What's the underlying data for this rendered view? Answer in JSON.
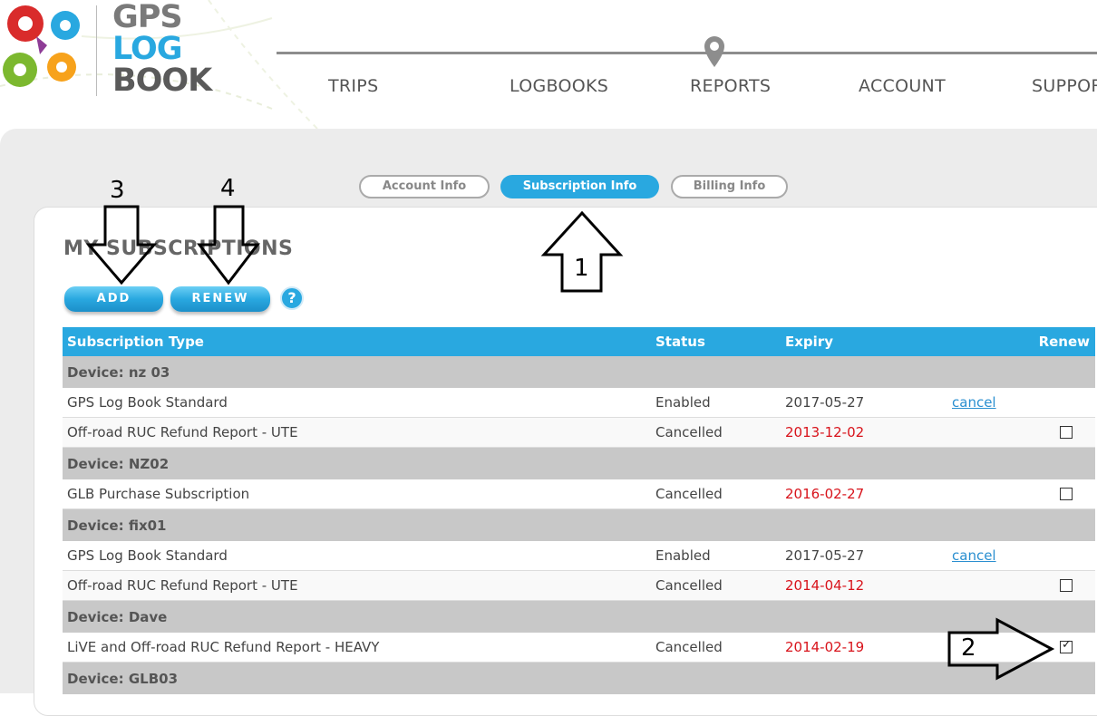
{
  "logo": {
    "line1": "GPS",
    "line2": "LOG",
    "line3": "BOOK"
  },
  "nav": {
    "items": [
      "TRIPS",
      "LOGBOOKS",
      "REPORTS",
      "ACCOUNT",
      "SUPPOR"
    ]
  },
  "tabs": {
    "account_info": "Account Info",
    "subscription_info": "Subscription Info",
    "billing_info": "Billing Info"
  },
  "section": {
    "title": "MY SUBSCRIPTIONS"
  },
  "buttons": {
    "add": "ADD",
    "renew": "RENEW",
    "help": "?"
  },
  "table": {
    "headers": {
      "type": "Subscription Type",
      "status": "Status",
      "expiry": "Expiry",
      "renew": "Renew"
    },
    "devices": [
      {
        "label": "Device: nz 03"
      },
      {
        "label": "Device: NZ02"
      },
      {
        "label": "Device: fix01"
      },
      {
        "label": "Device: Dave"
      },
      {
        "label": "Device: GLB03"
      }
    ],
    "rows": [
      {
        "type": "GPS Log Book Standard",
        "status": "Enabled",
        "expiry": "2017-05-27",
        "action": "cancel"
      },
      {
        "type": "Off-road RUC Refund Report - UTE",
        "status": "Cancelled",
        "expiry": "2013-12-02",
        "renew_checked": false
      },
      {
        "type": "GLB Purchase Subscription",
        "status": "Cancelled",
        "expiry": "2016-02-27",
        "renew_checked": false
      },
      {
        "type": "GPS Log Book Standard",
        "status": "Enabled",
        "expiry": "2017-05-27",
        "action": "cancel"
      },
      {
        "type": "Off-road RUC Refund Report - UTE",
        "status": "Cancelled",
        "expiry": "2014-04-12",
        "renew_checked": false
      },
      {
        "type": "LiVE and Off-road RUC Refund Report - HEAVY",
        "status": "Cancelled",
        "expiry": "2014-02-19",
        "renew_checked": true
      }
    ]
  },
  "annotations": {
    "n1": "1",
    "n2": "2",
    "n3": "3",
    "n4": "4"
  },
  "colors": {
    "accent": "#29a8e0",
    "expired": "#d8131b",
    "device_row": "#c8c8c8",
    "link": "#2a8fd0"
  }
}
